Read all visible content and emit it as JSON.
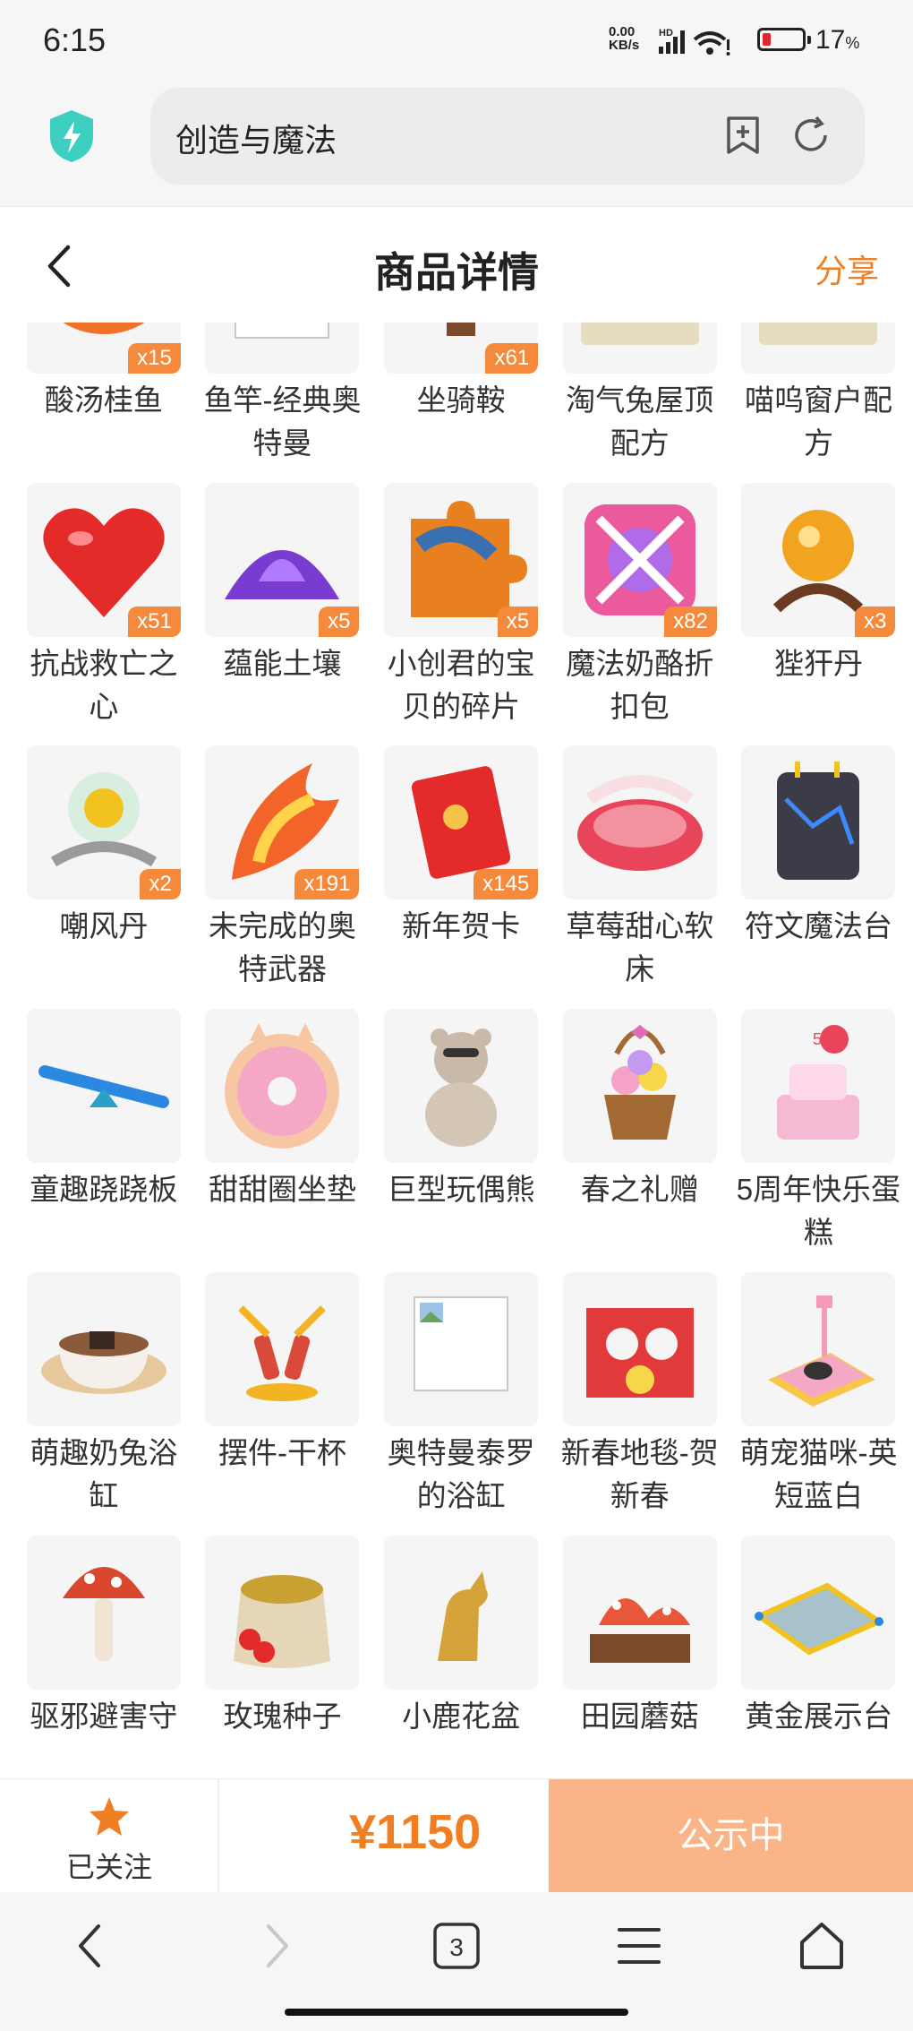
{
  "status": {
    "time": "6:15",
    "net_speed_value": "0.00",
    "net_speed_unit": "KB/s",
    "hd": "HD",
    "battery_percent": "17",
    "battery_sign": "%",
    "battery_level": 0.17
  },
  "browser": {
    "query": "创造与魔法",
    "tab_count": "3"
  },
  "header": {
    "title": "商品详情",
    "share_label": "分享"
  },
  "items": [
    {
      "name": "酸汤桂鱼",
      "qty": "x15",
      "icon": "fish-dish-icon"
    },
    {
      "name": "鱼竿-经典奥特曼",
      "qty": "",
      "icon": "image-placeholder-icon"
    },
    {
      "name": "坐骑鞍",
      "qty": "x61",
      "icon": "saddle-icon"
    },
    {
      "name": "淘气兔屋顶配方",
      "qty": "",
      "icon": "roof-recipe-icon"
    },
    {
      "name": "喵呜窗户配方",
      "qty": "",
      "icon": "window-recipe-icon"
    },
    {
      "name": "抗战救亡之心",
      "qty": "x51",
      "icon": "red-heart-icon"
    },
    {
      "name": "蕴能土壤",
      "qty": "x5",
      "icon": "purple-soil-icon"
    },
    {
      "name": "小创君的宝贝的碎片",
      "qty": "x5",
      "icon": "puzzle-piece-icon"
    },
    {
      "name": "魔法奶酪折扣包",
      "qty": "x82",
      "icon": "gift-box-icon"
    },
    {
      "name": "狴犴丹",
      "qty": "x3",
      "icon": "orb-pill-icon"
    },
    {
      "name": "嘲风丹",
      "qty": "x2",
      "icon": "green-orb-icon"
    },
    {
      "name": "未完成的奥特武器",
      "qty": "x191",
      "icon": "fire-weapon-icon"
    },
    {
      "name": "新年贺卡",
      "qty": "x145",
      "icon": "red-card-icon"
    },
    {
      "name": "草莓甜心软床",
      "qty": "",
      "icon": "strawberry-bed-icon"
    },
    {
      "name": "符文魔法台",
      "qty": "",
      "icon": "rune-altar-icon"
    },
    {
      "name": "童趣跷跷板",
      "qty": "",
      "icon": "seesaw-icon"
    },
    {
      "name": "甜甜圈坐垫",
      "qty": "",
      "icon": "donut-cushion-icon"
    },
    {
      "name": "巨型玩偶熊",
      "qty": "",
      "icon": "teddy-bear-icon"
    },
    {
      "name": "春之礼赠",
      "qty": "",
      "icon": "flower-basket-icon"
    },
    {
      "name": "5周年快乐蛋糕",
      "qty": "",
      "icon": "birthday-cake-icon"
    },
    {
      "name": "萌趣奶兔浴缸",
      "qty": "",
      "icon": "teacup-bath-icon"
    },
    {
      "name": "摆件-干杯",
      "qty": "",
      "icon": "cheers-ornament-icon"
    },
    {
      "name": "奥特曼泰罗的浴缸",
      "qty": "",
      "icon": "image-placeholder-icon"
    },
    {
      "name": "新春地毯-贺新春",
      "qty": "",
      "icon": "spring-carpet-icon"
    },
    {
      "name": "萌宠猫咪-英短蓝白",
      "qty": "",
      "icon": "pet-cat-icon"
    },
    {
      "name": "驱邪避害守",
      "qty": "",
      "icon": "mushroom-icon"
    },
    {
      "name": "玫瑰种子",
      "qty": "",
      "icon": "seed-sack-icon"
    },
    {
      "name": "小鹿花盆",
      "qty": "",
      "icon": "deer-pot-icon"
    },
    {
      "name": "田园蘑菇",
      "qty": "",
      "icon": "mushroom-garden-icon"
    },
    {
      "name": "黄金展示台",
      "qty": "",
      "icon": "display-platform-icon"
    }
  ],
  "footer": {
    "follow_label": "已关注",
    "price": "¥1150",
    "status_label": "公示中"
  },
  "colors": {
    "accent": "#f07f24",
    "badge": "#f58a3c",
    "status_button": "#fbb488"
  }
}
